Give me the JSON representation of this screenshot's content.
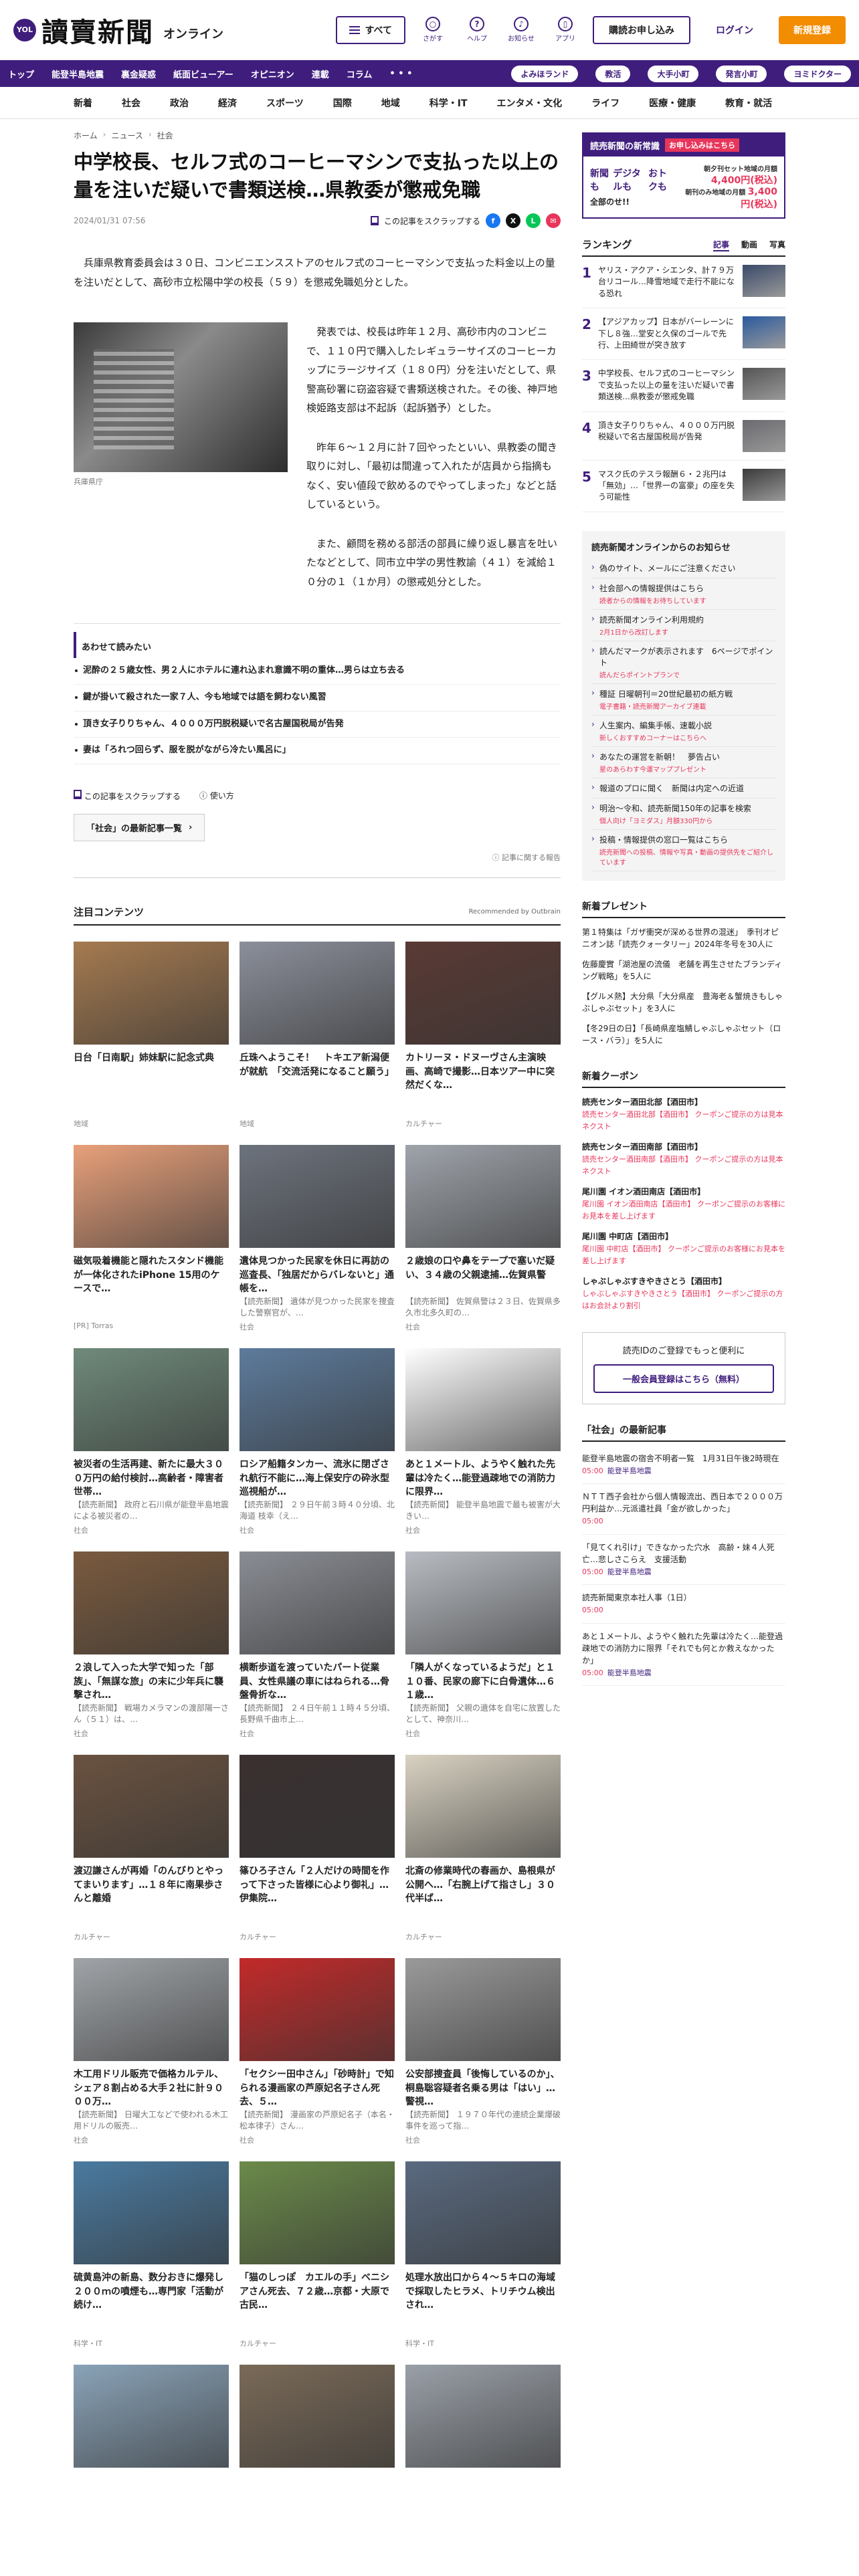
{
  "header": {
    "logo_badge": "YOL",
    "logo_text": "讀賣新聞",
    "logo_sub": "オンライン",
    "menu_label": "すべて",
    "tools": [
      {
        "icon": "search-icon",
        "label": "さがす"
      },
      {
        "icon": "help-icon",
        "label": "ヘルプ"
      },
      {
        "icon": "bell-icon",
        "label": "お知らせ"
      },
      {
        "icon": "app-icon",
        "label": "アプリ"
      }
    ],
    "subscribe_label": "購読お申し込み",
    "login_label": "ログイン",
    "register_label": "新規登録"
  },
  "nav1": {
    "items": [
      "トップ",
      "能登半島地震",
      "裏金疑惑",
      "紙面ビューアー",
      "オピニオン",
      "連載",
      "コラム",
      "• • •"
    ],
    "pills": [
      "よみほランド",
      "教活",
      "大手小町",
      "発言小町",
      "ヨミドクター"
    ]
  },
  "nav2": [
    "新着",
    "社会",
    "政治",
    "経済",
    "スポーツ",
    "国際",
    "地域",
    "科学・IT",
    "エンタメ・文化",
    "ライフ",
    "医療・健康",
    "教育・就活"
  ],
  "article": {
    "breadcrumb": [
      "ホーム",
      "ニュース",
      "社会"
    ],
    "headline": "中学校長、セルフ式のコーヒーマシンで支払った以上の量を注いだ疑いで書類送検…県教委が懲戒免職",
    "date": "2024/01/31 07:56",
    "scrap_label": "この記事をスクラップする",
    "lead": "兵庫県教育委員会は３０日、コンビニエンスストアのセルフ式のコーヒーマシンで支払った料金以上の量を注いだとして、高砂市立松陽中学の校長（５９）を懲戒免職処分とした。",
    "photo_caption": "兵庫県庁",
    "paragraphs": [
      "発表では、校長は昨年１２月、高砂市内のコンビニで、１１０円で購入したレギュラーサイズのコーヒーカップにラージサイズ（１８０円）分を注いだとして、県警高砂署に窃盗容疑で書類送検された。その後、神戸地検姫路支部は不起訴（起訴猶予）とした。",
      "昨年６～１２月に計７回やったといい、県教委の聞き取りに対し、「最初は間違って入れたが店員から指摘もなく、安い値段で飲めるのでやってしまった」などと話しているという。",
      "また、顧問を務める部活の部員に繰り返し暴言を吐いたなどとして、同市立中学の男性教諭（４１）を減給１０分の１（１か月）の懲戒処分とした。"
    ],
    "related_title": "あわせて読みたい",
    "related": [
      "泥酔の２５歳女性、男２人にホテルに連れ込まれ意識不明の重体…男らは立ち去る",
      "鍵が掛いて殺された一家７人、今も地域では語を飼わない風習",
      "頂き女子りりちゃん、４０００万円脱税疑いで名古屋国税局が告発",
      "妻は「ろれつ回らず、服を脱がながら冷たい風呂に」"
    ],
    "action_scrap": "この記事をスクラップする",
    "action_howto": "使い方",
    "latest_btn": "「社会」の最新記事一覧",
    "report": "記事に関する報告"
  },
  "featured": {
    "title": "注目コンテンツ",
    "recommended": "Recommended by Outbrain",
    "cards": [
      {
        "title": "日台「日南駅」姉妹駅に記念式典",
        "desc": "",
        "src": "地域",
        "color": "#a57a50"
      },
      {
        "title": "丘珠へようこそ！　トキエア新潟便が就航　「交流活発になること願う」",
        "desc": "",
        "src": "地域",
        "color": "#8b8f9a"
      },
      {
        "title": "カトリーヌ・ドヌーヴさん主演映画、高崎で撮影…日本ツアー中に突然だくな…",
        "desc": "",
        "src": "カルチャー",
        "color": "#5a3a34"
      },
      {
        "title": "磁気吸着機能と隠れたスタンド機能が一体化されたiPhone 15用のケースで…",
        "desc": "",
        "src": "[PR] Torras",
        "color": "#e8a07a"
      },
      {
        "title": "遺体見つかった民家を休日に再訪の巡査長、「独居だからバレないと」通帳を…",
        "desc": "【読売新聞】 遺体が見つかった民家を捜査した警察官が、…",
        "src": "社会",
        "color": "#6d737d"
      },
      {
        "title": "２歳娘の口や鼻をテープで塞いだ疑い、３４歳の父親逮捕…佐賀県警",
        "desc": "【読売新聞】 佐賀県警は２３日、佐賀県多久市北多久町の…",
        "src": "社会",
        "color": "#9fa4ab"
      },
      {
        "title": "被災者の生活再建、新たに最大３００万円の給付検討…高齢者・障害者世帯…",
        "desc": "【読売新聞】 政府と石川県が能登半島地震による被災者の…",
        "src": "社会",
        "color": "#6f8a7a"
      },
      {
        "title": "ロシア船籍タンカー、流氷に閉ざされ航行不能に…海上保安庁の砕氷型巡視船が…",
        "desc": "【読売新聞】 ２９日午前３時４０分頃、北海道 枝幸（え…",
        "src": "社会",
        "color": "#5d7b9c"
      },
      {
        "title": "あと１メートル、ようやく触れた先輩は冷たく…能登過疎地での消防力に限界…",
        "desc": "【読売新聞】 能登半島地震で最も被害が大きい…",
        "src": "社会",
        "color": "#ffffff"
      },
      {
        "title": "２浪して入った大学で知った「部族」、「無謀な旅」の末に少年兵に襲撃され…",
        "desc": "【読売新聞】 戦場カメラマンの渡部陽一さん（５１）は、…",
        "src": "社会",
        "color": "#7a5a3e"
      },
      {
        "title": "横断歩道を渡っていたパート従業員、女性県議の車にはねられる…骨盤骨折な…",
        "desc": "【読売新聞】 ２４日午前１１時４５分頃、長野県千曲市上…",
        "src": "社会",
        "color": "#8a8d94"
      },
      {
        "title": "「隣人がくなっているようだ」と１１０番、民家の廊下に白骨遺体…６１歳…",
        "desc": "【読売新聞】 父親の遺体を自宅に放置したとして、神奈川…",
        "src": "社会",
        "color": "#b8bcc2"
      },
      {
        "title": "渡辺謙さんが再婚「のんびりとやってまいります」…１８年に南果歩さんと離婚",
        "desc": "",
        "src": "カルチャー",
        "color": "#6a5240"
      },
      {
        "title": "篠ひろ子さん「２人だけの時間を作って下さった皆様に心より御礼」…伊集院…",
        "desc": "",
        "src": "カルチャー",
        "color": "#3a3030"
      },
      {
        "title": "北斎の修業時代の春画か、島根県が公開へ…「右腕上げて指さし」３０代半ば…",
        "desc": "",
        "src": "カルチャー",
        "color": "#d9d2c2"
      },
      {
        "title": "木工用ドリル販売で価格カルテル、シェア８割占める大手２社に計９０００万…",
        "desc": "【読売新聞】 日曜大工などで使われる木工用ドリルの販売…",
        "src": "社会",
        "color": "#a0a4a8"
      },
      {
        "title": "「セクシー田中さん」「砂時計」で知られる漫画家の芦原妃名子さん死去、５…",
        "desc": "【読売新聞】 漫画家の芦原妃名子（本名・松本律子）さん…",
        "src": "社会",
        "color": "#c22a2a"
      },
      {
        "title": "公安部捜査員「後悔しているのか」、桐島聡容疑者名乗る男は「はい」…警視…",
        "desc": "【読売新聞】 １９７０年代の連続企業爆破事件を巡って指…",
        "src": "社会",
        "color": "#9a9a9a"
      },
      {
        "title": "硫黄島沖の新島、数分おきに爆発し２００ｍの噴煙も…専門家「活動が続け…",
        "desc": "",
        "src": "科学・IT",
        "color": "#4a7aa0"
      },
      {
        "title": "「猫のしっぽ　カエルの手」ベニシアさん死去、７２歳…京都・大原で古民…",
        "desc": "",
        "src": "カルチャー",
        "color": "#6b8a4a"
      },
      {
        "title": "処理水放出口から４～５キロの海域で採取したヒラメ、トリチウム検出され…",
        "desc": "",
        "src": "科学・IT",
        "color": "#5a6a80"
      },
      {
        "title": "",
        "desc": "",
        "src": "",
        "color": "#8aa3b8"
      },
      {
        "title": "",
        "desc": "",
        "src": "",
        "color": "#7a6a58"
      },
      {
        "title": "",
        "desc": "",
        "src": "",
        "color": "#9aa0a8"
      }
    ]
  },
  "sidebar": {
    "promo": {
      "head": "読売新聞の新常識",
      "tag": "お申し込みはこちら",
      "tags": [
        "新聞も",
        "デジタルも",
        "おトクも"
      ],
      "suffix": "全部のせ!!",
      "price1_label": "朝夕刊セット地域の月額",
      "price1": "4,400円(税込)",
      "price2_label": "朝刊のみ地域の月額",
      "price2": "3,400円(税込)"
    },
    "ranking": {
      "title": "ランキング",
      "tabs": [
        "記事",
        "動画",
        "写真"
      ],
      "items": [
        {
          "no": "1",
          "text": "ヤリス・アクア・シエンタ、計７９万台リコール…降雪地域で走行不能になる恐れ",
          "color": "#3a4a6a"
        },
        {
          "no": "2",
          "text": "【アジアカップ】日本がバーレーンに下し８強…堂安と久保のゴールで先行、上田綺世が突き放す",
          "color": "#2a5aa0"
        },
        {
          "no": "3",
          "text": "中学校長、セルフ式のコーヒーマシンで支払った以上の量を注いだ疑いで書類送検…県教委が懲戒免職",
          "color": "#555555"
        },
        {
          "no": "4",
          "text": "頂き女子りりちゃん、４０００万円脱税疑いで名古屋国税局が告発",
          "color": "#6a6a70"
        },
        {
          "no": "5",
          "text": "マスク氏のテスラ報酬６・２兆円は「無効」…「世界一の富豪」の座を失う可能性",
          "color": "#3a3a3a"
        }
      ]
    },
    "notice": {
      "title": "読売新聞オンラインからのお知らせ",
      "items": [
        {
          "text": "偽のサイト、メールにご注意ください",
          "sub": ""
        },
        {
          "text": "社会部への情報提供はこちら",
          "sub": "読者からの情報をお待ちしています"
        },
        {
          "text": "読売新聞オンライン利用規約",
          "sub": "2月1日から改訂します"
        },
        {
          "text": "読んだマークが表示されます　6ページでポイント",
          "sub": "読んだらポイントプランで"
        },
        {
          "text": "種証 日曜朝刊＝20世紀最初の紙方戦",
          "sub": "電子書籍・読売新聞アーカイブ連載"
        },
        {
          "text": "人生案内、編集手帳、速載小説",
          "sub": "新しくおすすめコーナーはこちらへ"
        },
        {
          "text": "あなたの運営を新朝！　夢告占い",
          "sub": "星のあらわす今運マッププレゼント"
        },
        {
          "text": "報道のプロに聞く　新聞は内定への近道",
          "sub": ""
        },
        {
          "text": "明治～令和、読売新聞150年の記事を検索",
          "sub": "個人向け「ヨミダス」月額330円から"
        },
        {
          "text": "投稿・情報提供の窓口一覧はこちら",
          "sub": "読売新聞への投稿、情報や写真・動画の提供先をご紹介しています"
        }
      ]
    },
    "present": {
      "title": "新着プレゼント",
      "items": [
        "第１特集は「ガザ衝突が深める世界の混迷」　季刊オピニオン誌「読売クォータリー」2024年冬号を30人に",
        "佐藤慶實「湖池屋の流儀　老舗を再生させたブランディング戦略」を5人に",
        "【グルメ熱】大分県「大分県産　豊海老＆蟹焼きもしゃぶしゃぶセット」を3人に",
        "【冬29日の日】「長崎県産塩鯖しゃぶしゃぶセット（ロース・バラ）」を5人に"
      ]
    },
    "coupon": {
      "title": "新着クーポン",
      "items": [
        {
          "name": "読売センター酒田北部【酒田市】",
          "text": "読売センター酒田北部【酒田市】 クーポンご提示の方は見本ネクスト"
        },
        {
          "name": "読売センター酒田南部【酒田市】",
          "text": "読売センター酒田南部【酒田市】 クーポンご提示の方は見本ネクスト"
        },
        {
          "name": "尾川園 イオン酒田南店【酒田市】",
          "text": "尾川園 イオン酒田南店【酒田市】 クーポンご提示のお客様にお見本を差し上げます"
        },
        {
          "name": "尾川園 中町店【酒田市】",
          "text": "尾川園 中町店【酒田市】 クーポンご提示のお客様にお見本を差し上げます"
        },
        {
          "name": "しゃぶしゃぶすきやきさとう【酒田市】",
          "text": "しゃぶしゃぶすきやきさとう【酒田市】 クーポンご提示の方はお会計より割引"
        }
      ]
    },
    "reg": {
      "text": "読売IDのご登録でもっと便利に",
      "btn": "一般会員登録はこちら（無料）"
    },
    "latest": {
      "title": "「社会」の最新記事",
      "items": [
        {
          "text": "能登半島地震の宿舎不明者一覧　1月31日午後2時現在",
          "time": "05:00",
          "cat": "能登半島地震"
        },
        {
          "text": "ＮＴＴ西子会社から個人情報流出、西日本で２０００万円利益か…元派遣社員「金が欲しかった」",
          "time": "05:00",
          "cat": ""
        },
        {
          "text": "「見てくれ引け」できなかった穴水　高齢・妹４人死亡…悲しさこらえ　支援活動",
          "time": "05:00",
          "cat": "能登半島地震"
        },
        {
          "text": "読売新聞東京本社人事（1日）",
          "time": "05:00",
          "cat": ""
        },
        {
          "text": "あと１メートル、ようやく触れた先輩は冷たく…能登過疎地での消防力に限界「それでも何とか救えなかったか」",
          "time": "05:00",
          "cat": "能登半島地震"
        }
      ]
    }
  }
}
